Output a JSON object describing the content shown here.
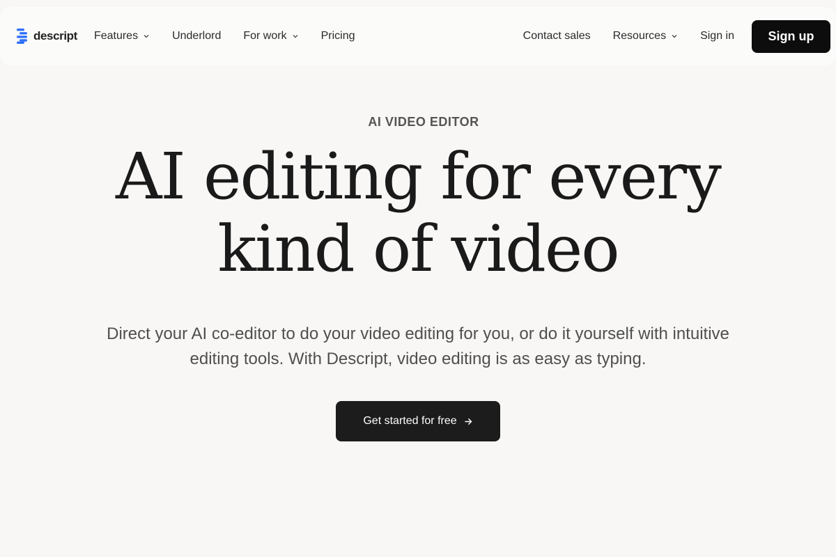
{
  "nav": {
    "logo_text": "descript",
    "items": [
      {
        "label": "Features",
        "has_dropdown": true
      },
      {
        "label": "Underlord",
        "has_dropdown": false
      },
      {
        "label": "For work",
        "has_dropdown": true
      },
      {
        "label": "Pricing",
        "has_dropdown": false
      }
    ],
    "right_items": [
      {
        "label": "Contact sales",
        "has_dropdown": false
      },
      {
        "label": "Resources",
        "has_dropdown": true
      },
      {
        "label": "Sign in",
        "has_dropdown": false
      }
    ],
    "signup_label": "Sign up"
  },
  "hero": {
    "eyebrow": "AI VIDEO EDITOR",
    "headline_line1": "AI editing for every",
    "headline_line2": "kind of video",
    "subtext": "Direct your AI co-editor to do your video editing for you, or do it yourself with intuitive editing tools. With Descript, video editing is as easy as typing.",
    "cta_label": "Get started for free"
  },
  "colors": {
    "background": "#f8f7f5",
    "nav_background": "#fbfbfa",
    "button_dark": "#0d0d0d",
    "brand_blue": "#2f6fff"
  },
  "icons": {
    "logo": "descript-logo-icon",
    "dropdown": "chevron-down-icon",
    "cta": "arrow-right-icon"
  }
}
